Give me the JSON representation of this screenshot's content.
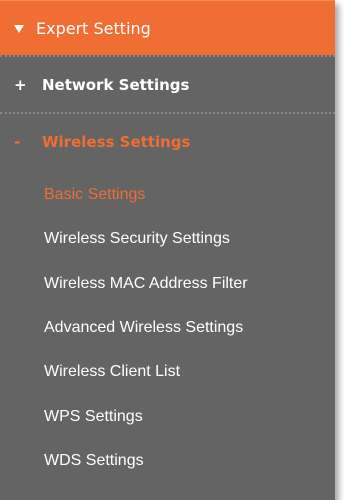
{
  "colors": {
    "accent": "#f06d34",
    "panel_bg": "#646464",
    "text": "#ffffff"
  },
  "header": {
    "icon": "triangle-down-icon",
    "title": "Expert Setting"
  },
  "menu": {
    "network": {
      "sign": "+",
      "label": "Network Settings",
      "state": "collapsed"
    },
    "wireless": {
      "sign": "-",
      "label": "Wireless Settings",
      "state": "expanded",
      "items": [
        {
          "label": "Basic Settings",
          "active": true
        },
        {
          "label": "Wireless Security Settings",
          "active": false
        },
        {
          "label": "Wireless MAC Address Filter",
          "active": false
        },
        {
          "label": "Advanced Wireless Settings",
          "active": false
        },
        {
          "label": "Wireless Client List",
          "active": false
        },
        {
          "label": "WPS Settings",
          "active": false
        },
        {
          "label": "WDS Settings",
          "active": false
        }
      ]
    }
  }
}
